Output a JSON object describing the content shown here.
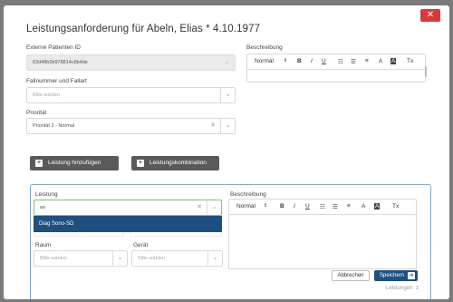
{
  "modal": {
    "title": "Leistungsanforderung für Abeln, Elias * 4.10.1977",
    "close_label": "✕"
  },
  "form": {
    "externe_patienten_id": {
      "label": "Externe Patienten ID",
      "value": "63d48b2b978814c8b4de"
    },
    "fallnummer": {
      "label": "Fallnummer und Fallart",
      "placeholder": "Bitte wählen"
    },
    "prioritaet": {
      "label": "Priorität",
      "value": "Priorität 2 - Normal"
    },
    "beschreibung": {
      "label": "Beschreibung",
      "format": "Normal"
    }
  },
  "actions": {
    "add_leistung": "Leistung hinzufügen",
    "add_kombination": "Leistungskombination"
  },
  "leistung_panel": {
    "leistung_label": "Leistung",
    "leistung_value": "so",
    "dropdown_option": "Diag Sono-SD",
    "raum_label": "Raum",
    "raum_placeholder": "Bitte wählen",
    "geraet_label": "Gerät",
    "geraet_placeholder": "Bitte wählen",
    "hidden_placeholder_1": "Bitte wählen",
    "hidden_placeholder_2": "Bitte wählen",
    "beschreibung_label": "Beschreibung",
    "format": "Normal",
    "cancel_label": "Abbrechen",
    "save_label": "Speichern",
    "count_label": "Leistungen: 1"
  },
  "toolbar": {
    "bold": "B",
    "italic": "I",
    "underline": "U"
  }
}
